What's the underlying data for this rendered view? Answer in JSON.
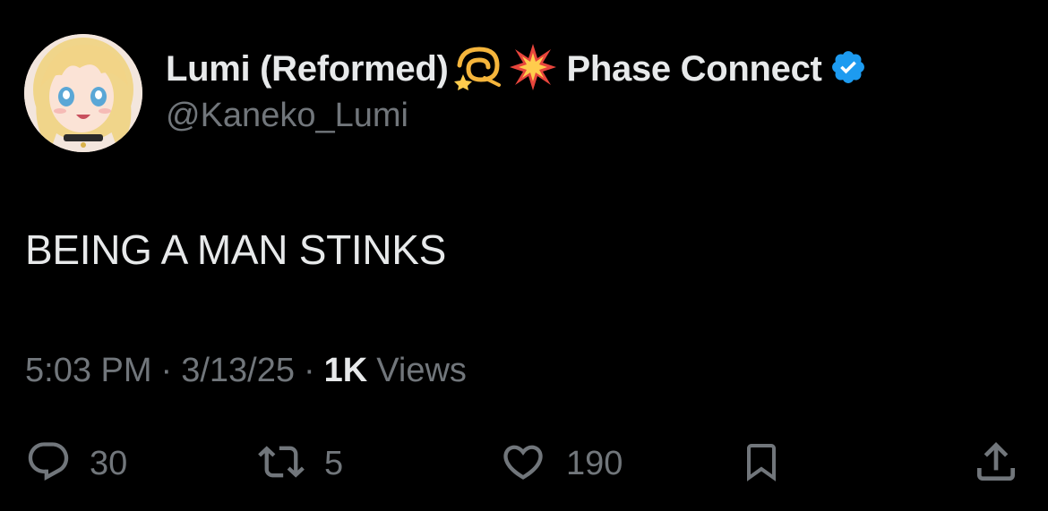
{
  "author": {
    "display_name": "Lumi (Reformed)",
    "emojis": [
      "dizzy-emoji",
      "collision-emoji"
    ],
    "affiliation": "Phase Connect",
    "handle": "@Kaneko_Lumi",
    "verified": true
  },
  "tweet": {
    "text": "BEING A MAN STINKS",
    "time": "5:03 PM",
    "separator": "·",
    "date": "3/13/25",
    "views_count": "1K",
    "views_label": "Views"
  },
  "actions": {
    "reply_count": "30",
    "retweet_count": "5",
    "like_count": "190"
  },
  "colors": {
    "background": "#000000",
    "text_primary": "#e7e9ea",
    "text_secondary": "#71767b",
    "verified": "#1d9bf0"
  }
}
